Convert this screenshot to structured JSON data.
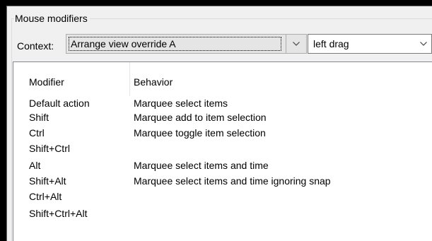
{
  "group": {
    "title": "Mouse modifiers"
  },
  "context": {
    "label": "Context:",
    "selected": "Arrange view override A",
    "action_selected": "left drag"
  },
  "table": {
    "columns": [
      "Modifier",
      "Behavior"
    ],
    "rows": [
      {
        "modifier": "Default action",
        "behavior": "Marquee select items"
      },
      {
        "modifier": "Shift",
        "behavior": "Marquee add to item selection"
      },
      {
        "modifier": "Ctrl",
        "behavior": "Marquee toggle item selection"
      },
      {
        "modifier": "Shift+Ctrl",
        "behavior": ""
      },
      {
        "modifier": "Alt",
        "behavior": "Marquee select items and time"
      },
      {
        "modifier": "Shift+Alt",
        "behavior": "Marquee select items and time ignoring snap"
      },
      {
        "modifier": "Ctrl+Alt",
        "behavior": ""
      },
      {
        "modifier": "Shift+Ctrl+Alt",
        "behavior": ""
      }
    ]
  },
  "icons": {
    "dropdown": "chevron-down-icon"
  },
  "colors": {
    "window_bg": "#f0f0f0",
    "list_bg": "#ffffff",
    "backdrop": "#000000"
  }
}
